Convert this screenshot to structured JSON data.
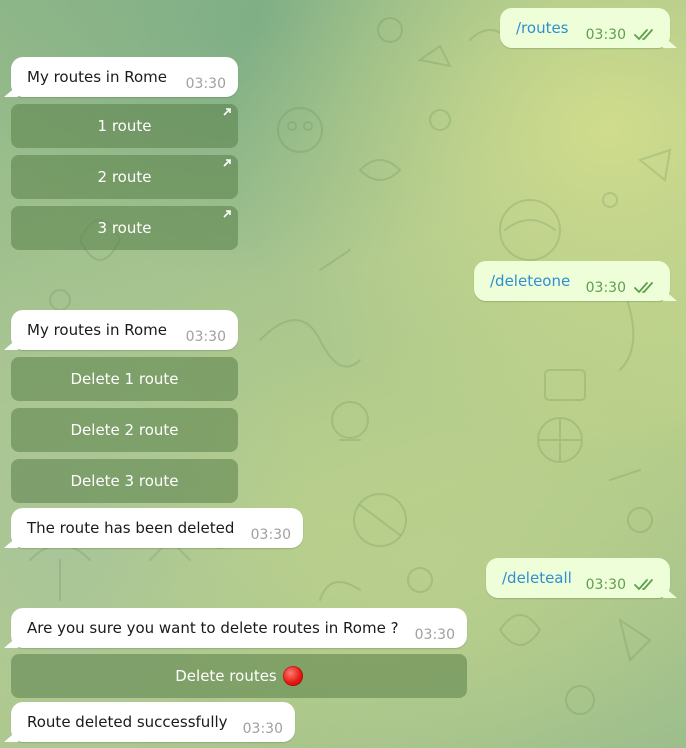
{
  "chat": {
    "messages": [
      {
        "type": "out",
        "text": "/routes",
        "time": "03:30"
      },
      {
        "type": "in",
        "text": "My routes in Rome",
        "time": "03:30"
      },
      {
        "type": "out",
        "text": "/deleteone",
        "time": "03:30"
      },
      {
        "type": "in",
        "text": "My routes in Rome",
        "time": "03:30"
      },
      {
        "type": "in",
        "text": "The route has been deleted",
        "time": "03:30"
      },
      {
        "type": "out",
        "text": "/deleteall",
        "time": "03:30"
      },
      {
        "type": "in",
        "text": "Are you sure you want to delete routes in Rome ?",
        "time": "03:30"
      },
      {
        "type": "in",
        "text": "Route deleted successfully",
        "time": "03:30"
      }
    ],
    "keyboards": {
      "routes": [
        "1 route",
        "2 route",
        "3 route"
      ],
      "delete": [
        "Delete 1 route",
        "Delete 2 route",
        "Delete 3 route"
      ],
      "confirm": "Delete routes"
    },
    "icons": {
      "read_receipt": "double-check-icon",
      "url_button": "external-link-arrow-icon",
      "confirm_emoji": "red-circle-icon"
    },
    "colors": {
      "outgoing_bubble": "#eefed9",
      "command_text": "#2f8fd0",
      "read_tick": "#5e9f4e",
      "incoming_bubble": "#ffffff",
      "keyboard_button": "#7a9b62",
      "red_circle": "#e41a12"
    }
  }
}
